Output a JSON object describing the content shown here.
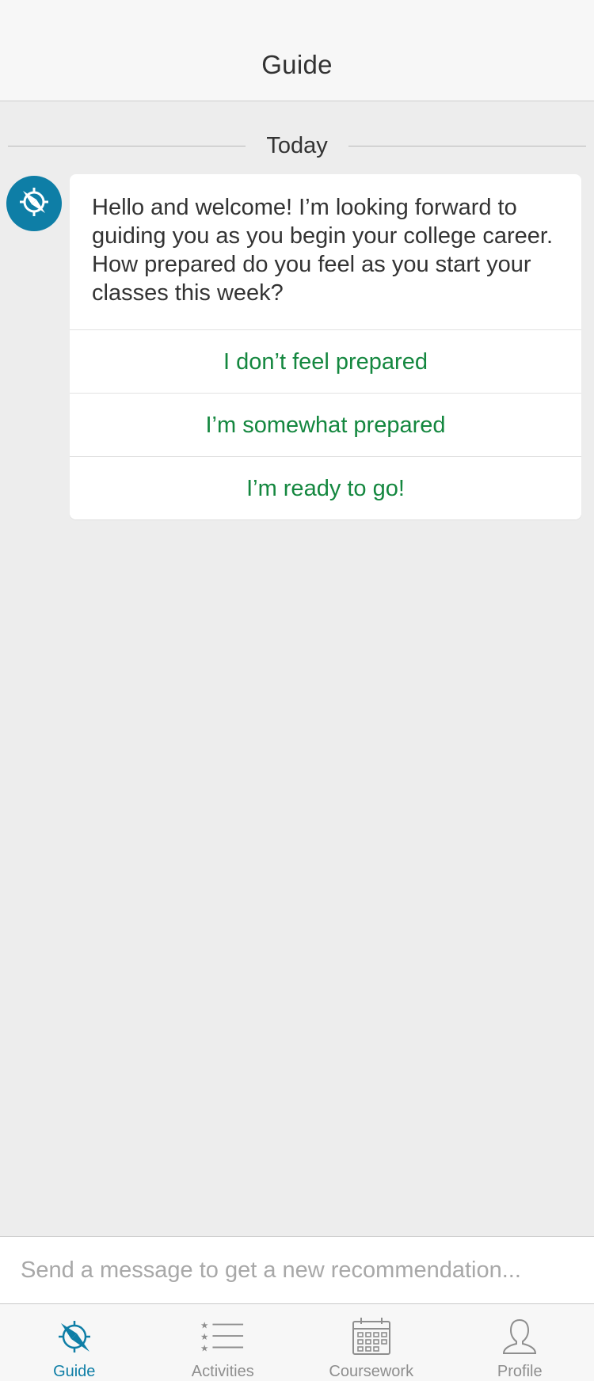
{
  "header": {
    "title": "Guide"
  },
  "divider": {
    "label": "Today"
  },
  "message": {
    "text": "Hello and welcome! I’m looking forward to guiding you as you begin your college career. How prepared do you feel as you start your classes this week?",
    "options": [
      {
        "label": "I don’t feel prepared"
      },
      {
        "label": "I’m somewhat prepared"
      },
      {
        "label": "I’m ready to go!"
      }
    ]
  },
  "composer": {
    "placeholder": "Send a message to get a new recommendation..."
  },
  "tabs": [
    {
      "label": "Guide",
      "icon": "compass-icon",
      "active": true
    },
    {
      "label": "Activities",
      "icon": "list-icon",
      "active": false
    },
    {
      "label": "Coursework",
      "icon": "calendar-icon",
      "active": false
    },
    {
      "label": "Profile",
      "icon": "person-icon",
      "active": false
    }
  ],
  "colors": {
    "accent": "#0e7ea6",
    "option_text": "#14873f",
    "background": "#ededed"
  }
}
